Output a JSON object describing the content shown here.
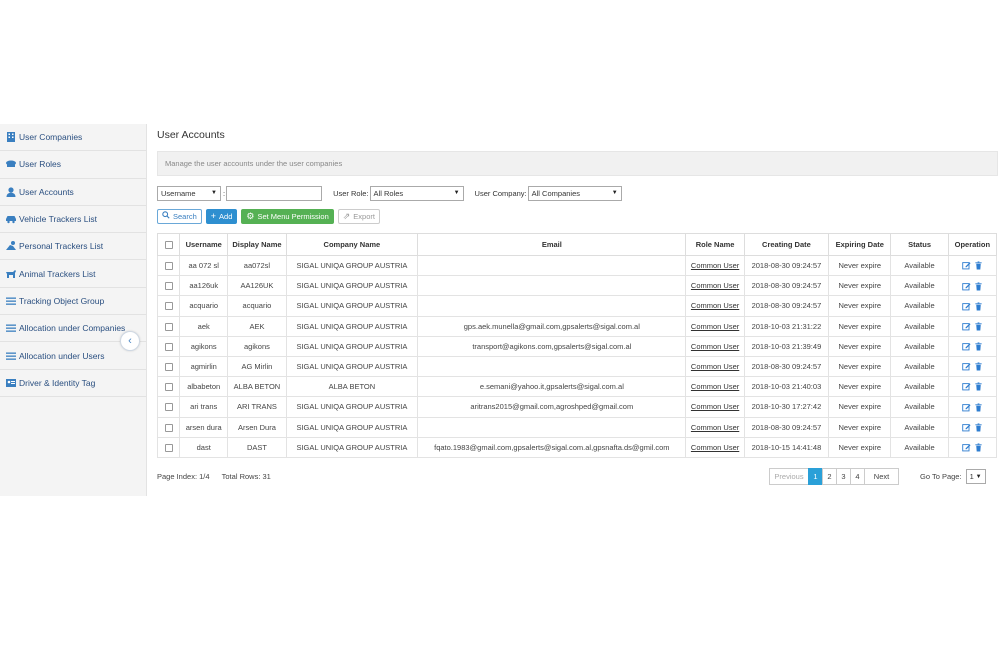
{
  "sidebar": {
    "items": [
      {
        "label": "User Companies",
        "icon": "building-icon"
      },
      {
        "label": "User Roles",
        "icon": "roles-icon"
      },
      {
        "label": "User Accounts",
        "icon": "user-icon"
      },
      {
        "label": "Vehicle Trackers List",
        "icon": "car-icon"
      },
      {
        "label": "Personal Trackers List",
        "icon": "person-tracker-icon"
      },
      {
        "label": "Animal Trackers List",
        "icon": "animal-icon"
      },
      {
        "label": "Tracking Object Group",
        "icon": "list-icon"
      },
      {
        "label": "Allocation under Companies",
        "icon": "list-icon"
      },
      {
        "label": "Allocation under Users",
        "icon": "list-icon"
      },
      {
        "label": "Driver & Identity Tag",
        "icon": "id-tag-icon"
      }
    ],
    "collapse_glyph": "‹"
  },
  "main": {
    "title": "User Accounts",
    "description": "Manage the user accounts under the user companies"
  },
  "filters": {
    "field_select": "Username",
    "colon": ":",
    "search_value": "",
    "role_label": "User Role:",
    "role_value": "All Roles",
    "company_label": "User Company:",
    "company_value": "All Companies",
    "arrow": "▼"
  },
  "toolbar": {
    "search_label": "Search",
    "add_label": "Add",
    "perm_label": "Set Menu Permission",
    "export_label": "Export"
  },
  "colors": {
    "accent": "#2e8fd0",
    "green": "#55b154",
    "active_page": "#2aa0d8"
  },
  "table": {
    "headers": [
      "Username",
      "Display Name",
      "Company Name",
      "Email",
      "Role Name",
      "Creating Date",
      "Expiring Date",
      "Status",
      "Operation"
    ],
    "rows": [
      {
        "username": "aa 072 sl",
        "display": "aa072sl",
        "company": "SIGAL UNIQA GROUP AUSTRIA",
        "email": "",
        "role": "Common User",
        "created": "2018-08-30 09:24:57",
        "expires": "Never expire",
        "status": "Available"
      },
      {
        "username": "aa126uk",
        "display": "AA126UK",
        "company": "SIGAL UNIQA GROUP AUSTRIA",
        "email": "",
        "role": "Common User",
        "created": "2018-08-30 09:24:57",
        "expires": "Never expire",
        "status": "Available"
      },
      {
        "username": "acquario",
        "display": "acquario",
        "company": "SIGAL UNIQA GROUP AUSTRIA",
        "email": "",
        "role": "Common User",
        "created": "2018-08-30 09:24:57",
        "expires": "Never expire",
        "status": "Available"
      },
      {
        "username": "aek",
        "display": "AEK",
        "company": "SIGAL UNIQA GROUP AUSTRIA",
        "email": "gps.aek.munella@gmail.com,gpsalerts@sigal.com.al",
        "role": "Common User",
        "created": "2018-10-03 21:31:22",
        "expires": "Never expire",
        "status": "Available"
      },
      {
        "username": "agikons",
        "display": "agikons",
        "company": "SIGAL UNIQA GROUP AUSTRIA",
        "email": "transport@agikons.com,gpsalerts@sigal.com.al",
        "role": "Common User",
        "created": "2018-10-03 21:39:49",
        "expires": "Never expire",
        "status": "Available"
      },
      {
        "username": "agmirlin",
        "display": "AG Mirlin",
        "company": "SIGAL UNIQA GROUP AUSTRIA",
        "email": "",
        "role": "Common User",
        "created": "2018-08-30 09:24:57",
        "expires": "Never expire",
        "status": "Available"
      },
      {
        "username": "albabeton",
        "display": "ALBA BETON",
        "company": "ALBA BETON",
        "email": "e.semani@yahoo.it,gpsalerts@sigal.com.al",
        "role": "Common User",
        "created": "2018-10-03 21:40:03",
        "expires": "Never expire",
        "status": "Available"
      },
      {
        "username": "ari trans",
        "display": "ARI TRANS",
        "company": "SIGAL UNIQA GROUP AUSTRIA",
        "email": "aritrans2015@gmail.com,agroshped@gmail.com",
        "role": "Common User",
        "created": "2018-10-30 17:27:42",
        "expires": "Never expire",
        "status": "Available"
      },
      {
        "username": "arsen dura",
        "display": "Arsen Dura",
        "company": "SIGAL UNIQA GROUP AUSTRIA",
        "email": "",
        "role": "Common User",
        "created": "2018-08-30 09:24:57",
        "expires": "Never expire",
        "status": "Available"
      },
      {
        "username": "dast",
        "display": "DAST",
        "company": "SIGAL UNIQA GROUP AUSTRIA",
        "email": "fqato.1983@gmail.com,gpsalerts@sigal.com.al,gpsnafta.ds@gmil.com",
        "role": "Common User",
        "created": "2018-10-15 14:41:48",
        "expires": "Never expire",
        "status": "Available"
      }
    ]
  },
  "footer": {
    "page_index": "Page Index: 1/4",
    "total_rows": "Total Rows: 31",
    "previous": "Previous",
    "pages": [
      "1",
      "2",
      "3",
      "4"
    ],
    "next": "Next",
    "goto_label": "Go To Page:",
    "goto_value": "1"
  }
}
